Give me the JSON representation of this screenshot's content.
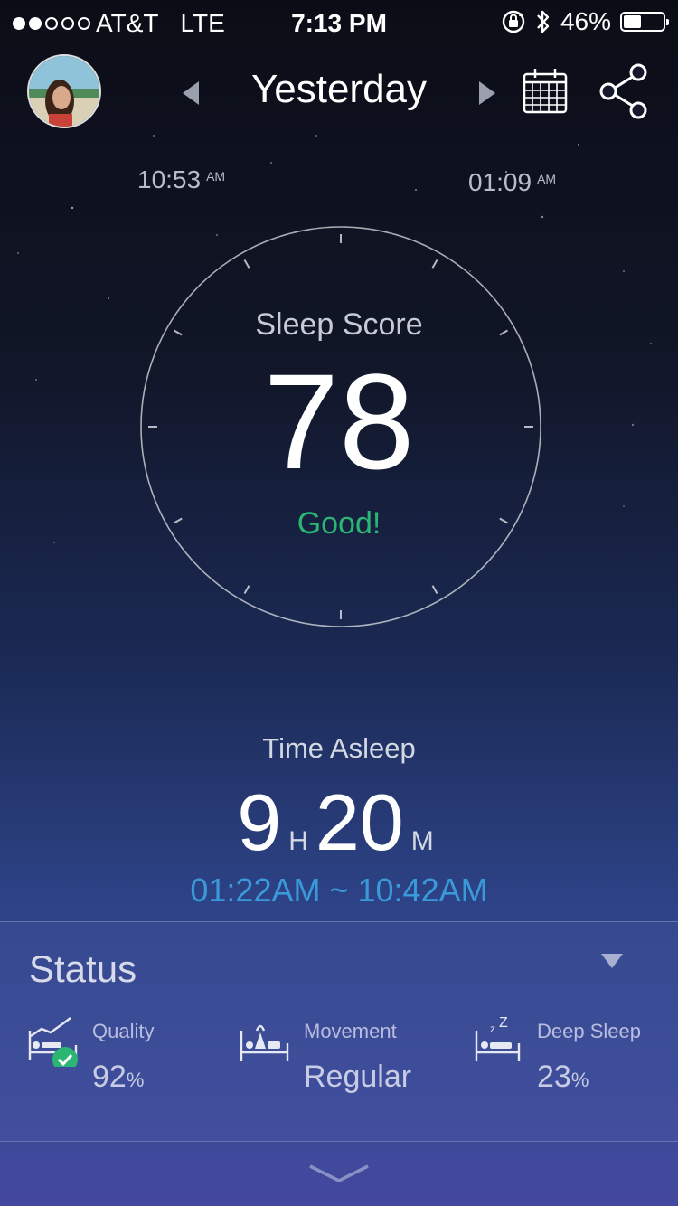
{
  "status_bar": {
    "carrier": "AT&T",
    "network": "LTE",
    "time": "7:13 PM",
    "battery": "46%",
    "battery_level": 0.46,
    "signal_bars_filled": 2,
    "signal_bars_total": 5
  },
  "header": {
    "title": "Yesterday"
  },
  "sleep_window": {
    "start_time": "10:53",
    "start_ampm": "AM",
    "end_time": "01:09",
    "end_ampm": "AM"
  },
  "score": {
    "label": "Sleep Score",
    "value": "78",
    "rating": "Good!",
    "rating_color": "#2bb673"
  },
  "asleep": {
    "label": "Time Asleep",
    "hours": "9",
    "hours_unit": "H",
    "minutes": "20",
    "minutes_unit": "M",
    "range": "01:22AM ~ 10:42AM",
    "range_color": "#3a9ad9"
  },
  "status": {
    "title": "Status",
    "metrics": [
      {
        "label": "Quality",
        "value": "92",
        "unit": "%",
        "icon": "quality-bed-chart-icon"
      },
      {
        "label": "Movement",
        "value": "Regular",
        "unit": "",
        "icon": "movement-bed-icon"
      },
      {
        "label": "Deep Sleep",
        "value": "23",
        "unit": "%",
        "icon": "deep-sleep-bed-icon"
      }
    ]
  }
}
